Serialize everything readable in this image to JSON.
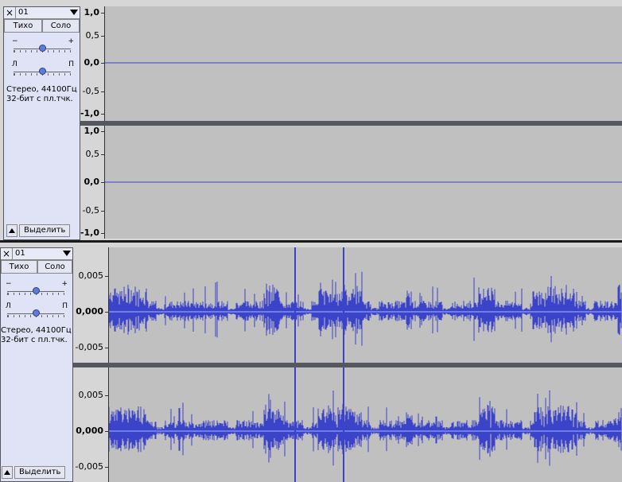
{
  "track1": {
    "name": "01",
    "mute_label": "Тихо",
    "solo_label": "Соло",
    "gain_minus": "−",
    "gain_plus": "+",
    "gain_value": 0.5,
    "pan_left": "Л",
    "pan_right": "П",
    "pan_value": 0.5,
    "info_line1": "Стерео, 44100Гц",
    "info_line2": "32-бит с пл.тчк.",
    "select_label": "Выделить",
    "scale_ticks": [
      "1,0",
      "0,5",
      "0,0",
      "-0,5",
      "-1,0"
    ]
  },
  "track2": {
    "name": "01",
    "mute_label": "Тихо",
    "solo_label": "Соло",
    "gain_minus": "−",
    "gain_plus": "+",
    "gain_value": 0.5,
    "pan_left": "Л",
    "pan_right": "П",
    "pan_value": 0.5,
    "info_line1": "Стерео, 44100Гц",
    "info_line2": "32-бит с пл.тчк.",
    "select_label": "Выделить",
    "scale_ticks": [
      "0,005",
      "0,000",
      "-0,005"
    ]
  },
  "colors": {
    "wave": "#3b44c9",
    "background": "#c0c0c0",
    "panel": "#dfe3f5"
  }
}
